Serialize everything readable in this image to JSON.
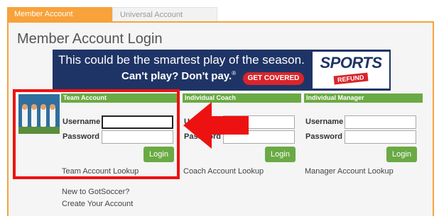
{
  "tabs": [
    {
      "label": "Member Account",
      "active": true
    },
    {
      "label": "Universal Account",
      "active": false
    }
  ],
  "page": {
    "title": "Member Account Login"
  },
  "banner": {
    "headline": "This could be the smartest play of the season.",
    "subline": "Can't play? Don't pay.",
    "subline_mark": "®",
    "cta": "GET COVERED",
    "logo_top": "SPORTS",
    "logo_bottom": "REFUND"
  },
  "login_columns": [
    {
      "header": "Team Account",
      "username_label": "Username",
      "password_label": "Password",
      "username_value": "",
      "password_value": "",
      "button_label": "Login",
      "lookup_label": "Team Account Lookup"
    },
    {
      "header": "Individual Coach",
      "username_label": "Username",
      "password_label": "Password",
      "username_value": "",
      "password_value": "",
      "button_label": "Login",
      "lookup_label": "Coach Account Lookup"
    },
    {
      "header": "Individual Manager",
      "username_label": "Username",
      "password_label": "Password",
      "username_value": "",
      "password_value": "",
      "button_label": "Login",
      "lookup_label": "Manager Account Lookup"
    }
  ],
  "footer": {
    "new_text": "New to GotSoccer?",
    "create_link": "Create Your Account"
  },
  "icons": {
    "team_image": "team-photo-icon",
    "annotation_arrow": "left-arrow-icon"
  },
  "colors": {
    "accent_orange": "#f7a23a",
    "header_green": "#6aaa44",
    "banner_navy": "#1f3466",
    "annotation_red": "#ee1111"
  }
}
